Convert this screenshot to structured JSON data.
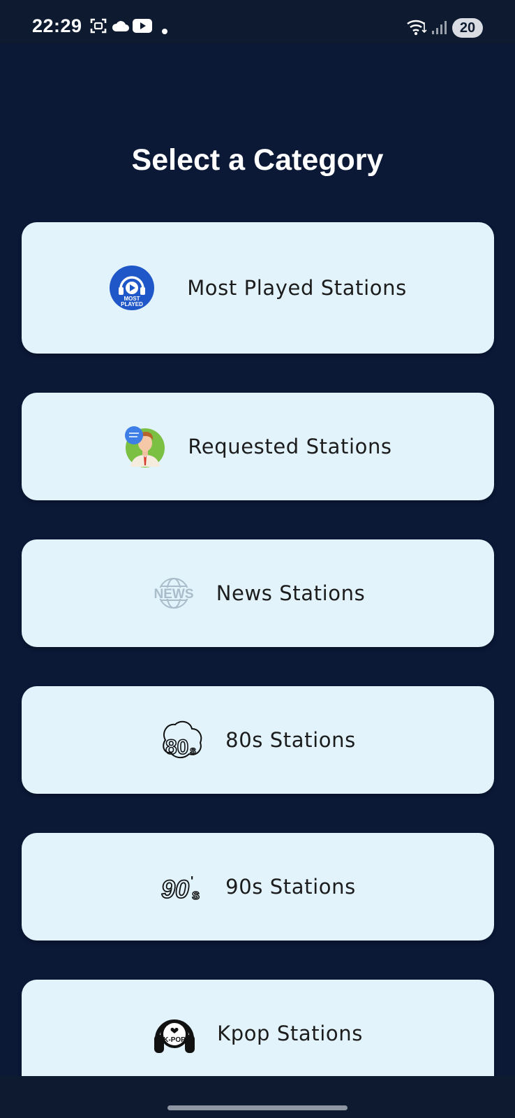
{
  "status_bar": {
    "time": "22:29",
    "battery": "20",
    "icons": [
      "screenshot-icon",
      "cloud-icon",
      "youtube-icon",
      "notification-dot-icon",
      "wifi-icon",
      "signal-icon"
    ]
  },
  "page": {
    "title": "Select a Category"
  },
  "categories": [
    {
      "label": "Most Played Stations",
      "icon": "most-played-icon",
      "icon_text": "MOST PLAYED"
    },
    {
      "label": "Requested Stations",
      "icon": "requested-person-icon"
    },
    {
      "label": "News Stations",
      "icon": "news-globe-icon",
      "icon_text": "NEWS"
    },
    {
      "label": "80s Stations",
      "icon": "80s-icon",
      "icon_text": "80s"
    },
    {
      "label": "90s Stations",
      "icon": "90s-icon",
      "icon_text": "90's"
    },
    {
      "label": "Kpop Stations",
      "icon": "kpop-headphones-icon",
      "icon_text": "K-POP"
    }
  ],
  "colors": {
    "background": "#0b1836",
    "card": "#e2f3fc",
    "status_bar": "#0e1a2f"
  }
}
